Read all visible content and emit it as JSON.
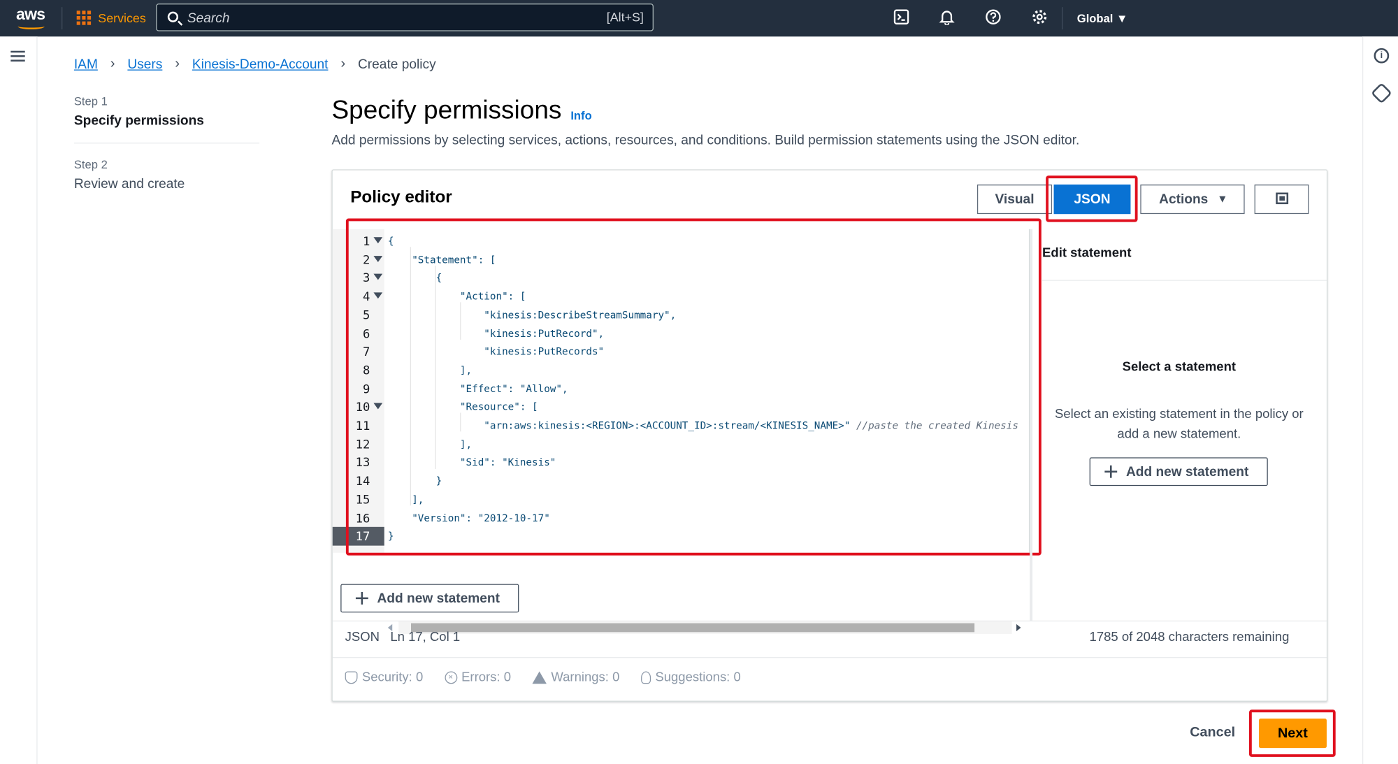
{
  "topnav": {
    "logo": "aws",
    "services_label": "Services",
    "search_placeholder": "Search",
    "search_shortcut": "[Alt+S]",
    "region": "Global",
    "icons": [
      "cloudshell-icon",
      "bell-icon",
      "help-icon",
      "gear-icon"
    ]
  },
  "breadcrumb": {
    "items": [
      "IAM",
      "Users",
      "Kinesis-Demo-Account"
    ],
    "current": "Create policy"
  },
  "steps": [
    {
      "kicker": "Step 1",
      "title": "Specify permissions"
    },
    {
      "kicker": "Step 2",
      "title": "Review and create"
    }
  ],
  "page": {
    "title": "Specify permissions",
    "info": "Info",
    "description": "Add permissions by selecting services, actions, resources, and conditions. Build permission statements using the JSON editor."
  },
  "editor": {
    "title": "Policy editor",
    "tabs": {
      "visual": "Visual",
      "json": "JSON",
      "actions": "Actions"
    },
    "lines": [
      {
        "n": "1",
        "fold": true,
        "text": "{"
      },
      {
        "n": "2",
        "fold": true,
        "text": "    \"Statement\": ["
      },
      {
        "n": "3",
        "fold": true,
        "text": "        {"
      },
      {
        "n": "4",
        "fold": true,
        "text": "            \"Action\": ["
      },
      {
        "n": "5",
        "fold": false,
        "text": "                \"kinesis:DescribeStreamSummary\","
      },
      {
        "n": "6",
        "fold": false,
        "text": "                \"kinesis:PutRecord\","
      },
      {
        "n": "7",
        "fold": false,
        "text": "                \"kinesis:PutRecords\""
      },
      {
        "n": "8",
        "fold": false,
        "text": "            ],"
      },
      {
        "n": "9",
        "fold": false,
        "text": "            \"Effect\": \"Allow\","
      },
      {
        "n": "10",
        "fold": true,
        "text": "            \"Resource\": ["
      },
      {
        "n": "11",
        "fold": false,
        "text": "                \"arn:aws:kinesis:<REGION>:<ACCOUNT_ID>:stream/<KINESIS_NAME>\" ",
        "comment": "//paste the created Kinesis"
      },
      {
        "n": "12",
        "fold": false,
        "text": "            ],"
      },
      {
        "n": "13",
        "fold": false,
        "text": "            \"Sid\": \"Kinesis\""
      },
      {
        "n": "14",
        "fold": false,
        "text": "        }"
      },
      {
        "n": "15",
        "fold": false,
        "text": "    ],"
      },
      {
        "n": "16",
        "fold": false,
        "text": "    \"Version\": \"2012-10-17\""
      },
      {
        "n": "17",
        "fold": false,
        "text": "}"
      }
    ],
    "add_statement": "Add new statement",
    "side": {
      "title": "Edit statement",
      "empty_title": "Select a statement",
      "empty_desc": "Select an existing statement in the policy or add a new statement.",
      "add_statement": "Add new statement"
    },
    "status": {
      "mode": "JSON",
      "position": "Ln 17, Col 1",
      "remaining": "1785 of 2048 characters remaining"
    },
    "validation": [
      {
        "label": "Security: 0",
        "icon": "shield-icon"
      },
      {
        "label": "Errors: 0",
        "icon": "error-icon"
      },
      {
        "label": "Warnings: 0",
        "icon": "warning-icon"
      },
      {
        "label": "Suggestions: 0",
        "icon": "lightbulb-icon"
      }
    ]
  },
  "footer": {
    "cancel": "Cancel",
    "next": "Next"
  },
  "colors": {
    "accent": "#0972d3",
    "primary_button": "#ff9900",
    "highlight": "#e0101e",
    "nav_bg": "#232f3e"
  }
}
